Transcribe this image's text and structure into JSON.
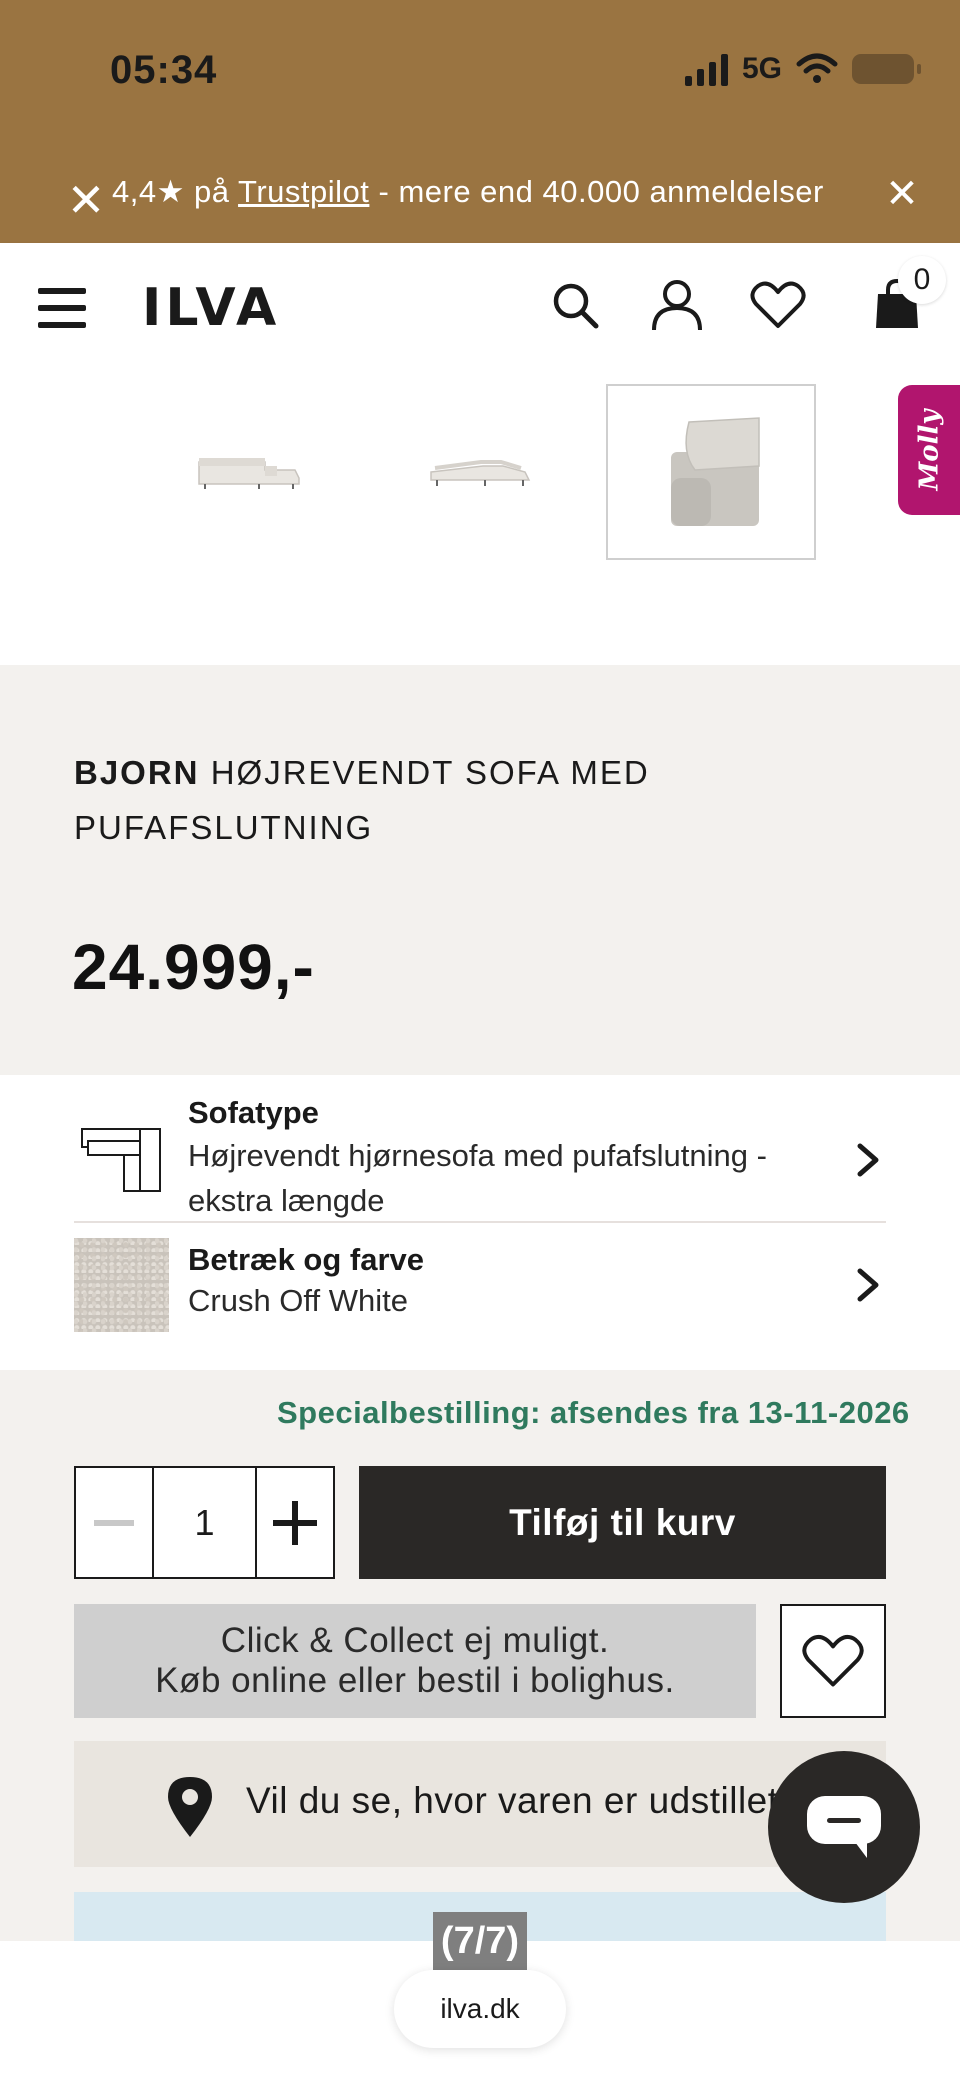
{
  "status_bar": {
    "time": "05:34",
    "network": "5G",
    "battery": "23"
  },
  "trust_banner": {
    "prefix": "4,4★ på ",
    "link": "Trustpilot",
    "suffix": " - mere end 40.000 anmeldelser",
    "close_left": "✕",
    "close_right": "✕"
  },
  "header": {
    "logo": "ILVA",
    "cart_count": "0",
    "icons": [
      "menu-icon",
      "search-icon",
      "account-icon",
      "heart-icon",
      "cart-icon"
    ]
  },
  "gallery": {
    "thumbnails": [
      "sofa-thumb-1",
      "sofa-thumb-2",
      "sofa-detail-thumb"
    ],
    "selected_index": 2,
    "molly_tab": "Molly"
  },
  "product": {
    "brand": "BJORN",
    "name": " HØJREVENDT SOFA MED PUFAFSLUTNING",
    "price": "24.999,-"
  },
  "options": {
    "sofatype": {
      "title": "Sofatype",
      "value": "Højrevendt hjørnesofa med pufafslutning - ekstra længde"
    },
    "fabric": {
      "title": "Betræk og farve",
      "value": "Crush Off White"
    }
  },
  "purchase": {
    "delivery_note": "Specialbestilling: afsendes fra 13-11-2026",
    "quantity": "1",
    "add_to_cart": "Tilføj til kurv",
    "click_collect_line1": "Click & Collect ej muligt.",
    "click_collect_line2": "Køb online eller bestil i bolighus.",
    "store_locator": "Vil du se, hvor varen er udstillet?"
  },
  "browser": {
    "page_counter": "(7/7)",
    "url": "ilva.dk"
  },
  "colors": {
    "banner": "#9a7441",
    "delivery_green": "#2f7a5e",
    "cta_dark": "#2a2826",
    "molly_magenta": "#b1156e"
  }
}
